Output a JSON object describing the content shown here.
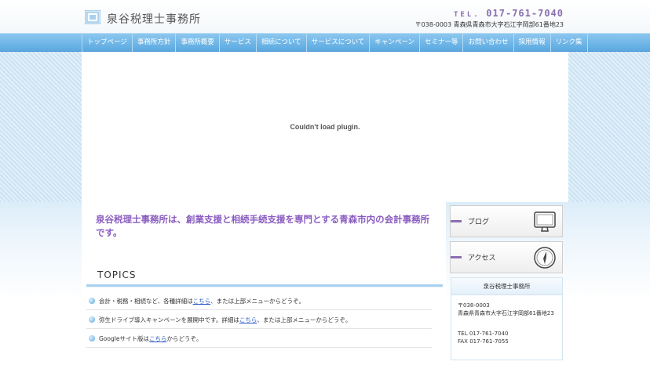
{
  "header": {
    "logo_text": "泉谷税理士事務所",
    "tel_prefix": "TEL.",
    "tel_number": "017-761-7040",
    "address": "〒038-0003 青森県青森市大字石江字岡部61番地23"
  },
  "nav": {
    "items": [
      "トップページ",
      "事務所方針",
      "事務所概要",
      "サービス",
      "相続について",
      "サービスについて",
      "キャンペーン",
      "セミナー等",
      "お問い合わせ",
      "採用情報",
      "リンク集"
    ]
  },
  "plugin": {
    "message": "Couldn't load plugin."
  },
  "main": {
    "lead": "泉谷税理士事務所は、創業支援と相続手続支援を専門とする青森市内の会計事務所です。",
    "topics_title": "TOPICS",
    "topics": [
      {
        "before": "会計・税務・相続など、各種詳細は",
        "link": "こちら",
        "after": "、または上部メニューからどうぞ。"
      },
      {
        "before": "弥生ドライブ導入キャンペーンを展開中です。詳細は",
        "link": "こちら",
        "after": "、または上部メニューからどうぞ。"
      },
      {
        "before": "Googleサイト版は",
        "link": "こちら",
        "after": "からどうぞ。"
      }
    ]
  },
  "sidebar": {
    "blog_label": "ブログ",
    "access_label": "アクセス",
    "info_title": "泉谷税理士事務所",
    "postal": "〒038-0003",
    "address": "青森県青森市大字石江字岡部61番地23",
    "tel": "TEL 017-761-7040",
    "fax": "FAX 017-761-7055"
  },
  "colors": {
    "accent_purple": "#8a5cc0",
    "nav_blue": "#5aa9e0",
    "link_blue": "#2a59c9"
  }
}
